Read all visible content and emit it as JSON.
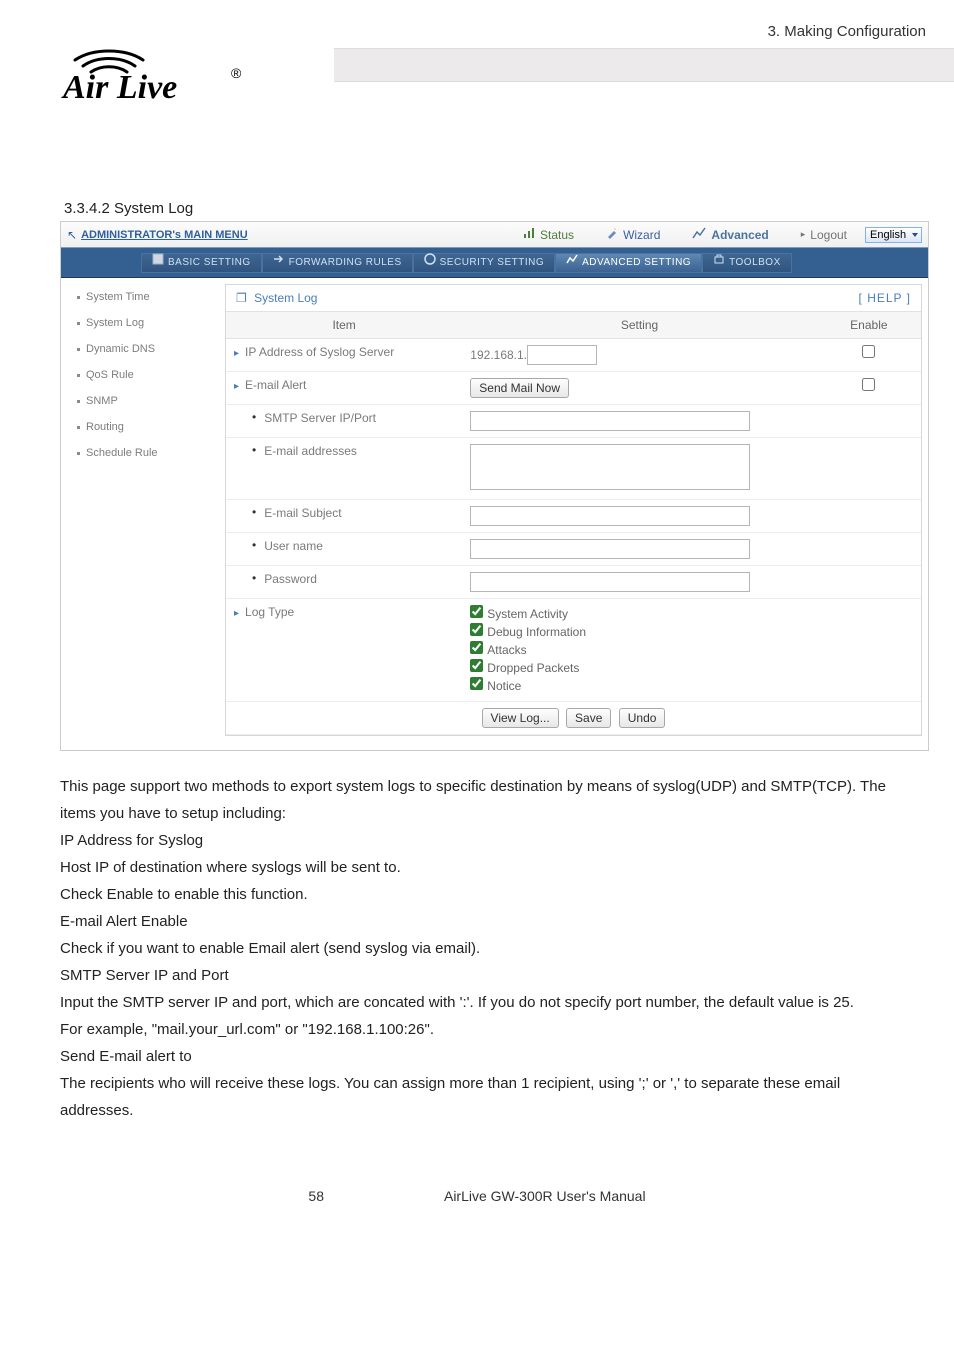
{
  "doc": {
    "chapter_line": "3.  Making  Configuration",
    "section_heading": "3.3.4.2 System Log",
    "page_number": "58",
    "manual_title": "AirLive GW-300R User's Manual",
    "logo_text": "Air Live",
    "logo_reg": "®"
  },
  "topbar": {
    "left": "ADMINISTRATOR's MAIN MENU",
    "status": "Status",
    "wizard": "Wizard",
    "advanced": "Advanced",
    "logout": "Logout",
    "language": "English"
  },
  "tabs": {
    "basic": "BASIC SETTING",
    "forwarding": "FORWARDING RULES",
    "security": "SECURITY SETTING",
    "advanced": "ADVANCED SETTING",
    "toolbox": "TOOLBOX"
  },
  "sidebar": {
    "items": [
      {
        "label": "System Time"
      },
      {
        "label": "System Log"
      },
      {
        "label": "Dynamic DNS"
      },
      {
        "label": "QoS Rule"
      },
      {
        "label": "SNMP"
      },
      {
        "label": "Routing"
      },
      {
        "label": "Schedule Rule"
      }
    ]
  },
  "panel": {
    "title": "System Log",
    "help": "[ HELP ]",
    "cols": {
      "item": "Item",
      "setting": "Setting",
      "enable": "Enable"
    },
    "rows": {
      "ip_syslog_label": "IP Address of Syslog Server",
      "ip_syslog_value": "192.168.1.",
      "email_alert": "E-mail Alert",
      "send_mail_btn": "Send Mail Now",
      "smtp_label": "SMTP Server IP/Port",
      "email_addr_label": "E-mail addresses",
      "email_subject_label": "E-mail Subject",
      "username_label": "User name",
      "password_label": "Password",
      "log_type_label": "Log Type",
      "log_types": {
        "sys": "System Activity",
        "debug": "Debug Information",
        "attacks": "Attacks",
        "dropped": "Dropped Packets",
        "notice": "Notice"
      }
    },
    "buttons": {
      "viewlog": "View Log...",
      "save": "Save",
      "undo": "Undo"
    }
  },
  "body": {
    "p1": "This page support two methods to export system logs to specific destination by means of syslog(UDP) and SMTP(TCP). The items you have to setup including:",
    "l1": "IP Address for Syslog",
    "l2": "Host IP of destination where syslogs will be sent to.",
    "l3": "Check Enable to enable this function.",
    "l4": "E-mail Alert Enable",
    "l5": "Check if you want to enable Email alert (send syslog via email).",
    "l6": "SMTP Server IP and Port",
    "l7": "Input the SMTP server IP and port, which are concated with ':'. If you do not specify port number, the default value is 25.",
    "l8": "For example, \"mail.your_url.com\" or \"192.168.1.100:26\".",
    "l9": "Send E-mail alert to",
    "l10": "The recipients who will receive these logs. You can assign more than 1 recipient, using ';' or ',' to separate these email addresses."
  }
}
